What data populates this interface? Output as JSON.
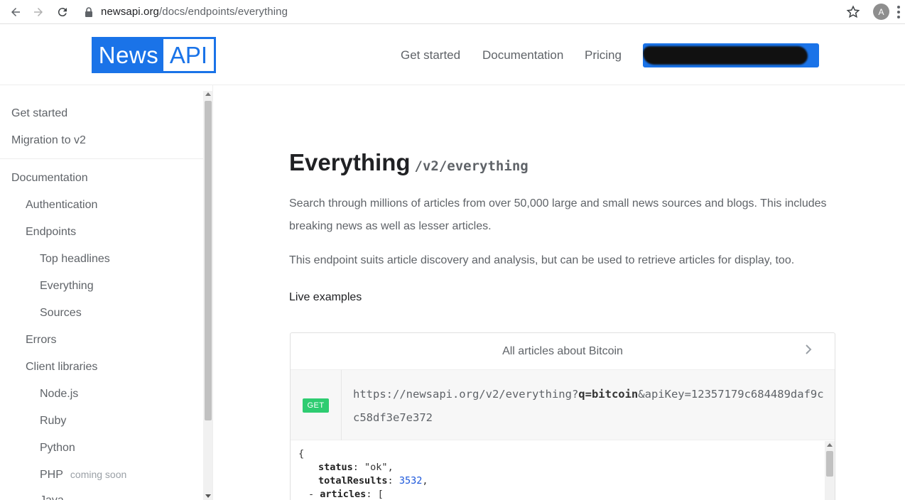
{
  "browser": {
    "url_host": "newsapi.org",
    "url_path": "/docs/endpoints/everything",
    "avatar_letter": "A",
    "icons": [
      "back-arrow-icon",
      "forward-arrow-icon",
      "reload-icon",
      "lock-icon",
      "star-icon",
      "menu-dots-icon"
    ]
  },
  "header": {
    "logo_left": "News",
    "logo_right": "API",
    "nav": [
      "Get started",
      "Documentation",
      "Pricing"
    ],
    "brand_color": "#1a73e8"
  },
  "sidebar": {
    "top_items": [
      "Get started",
      "Migration to v2"
    ],
    "section": "Documentation",
    "items": {
      "authentication": "Authentication",
      "endpoints": "Endpoints",
      "top_headlines": "Top headlines",
      "everything": "Everything",
      "sources": "Sources",
      "errors": "Errors",
      "client_libraries": "Client libraries",
      "nodejs": "Node.js",
      "ruby": "Ruby",
      "python": "Python",
      "php": "PHP",
      "php_badge": "coming soon",
      "java": "Java"
    }
  },
  "main": {
    "title": "Everything",
    "endpoint": "/v2/everything",
    "para1": "Search through millions of articles from over 50,000 large and small news sources and blogs. This includes breaking news as well as lesser articles.",
    "para2": "This endpoint suits article discovery and analysis, but can be used to retrieve articles for display, too.",
    "live_examples": "Live examples",
    "example": {
      "title": "All articles about Bitcoin",
      "method": "GET",
      "url_prefix": "https://newsapi.org/v2/everything?",
      "url_query": "q=bitcoin",
      "url_suffix": "&apiKey=12357179c684489daf9cc58df3e7e372",
      "response": {
        "open_brace": "{",
        "status_key": "status",
        "status_value": "\"ok\"",
        "total_key": "totalResults",
        "total_value": "3532",
        "articles_toggle": "-",
        "articles_key": "articles",
        "articles_open": "["
      }
    },
    "get_badge_color": "#2ecc71"
  }
}
